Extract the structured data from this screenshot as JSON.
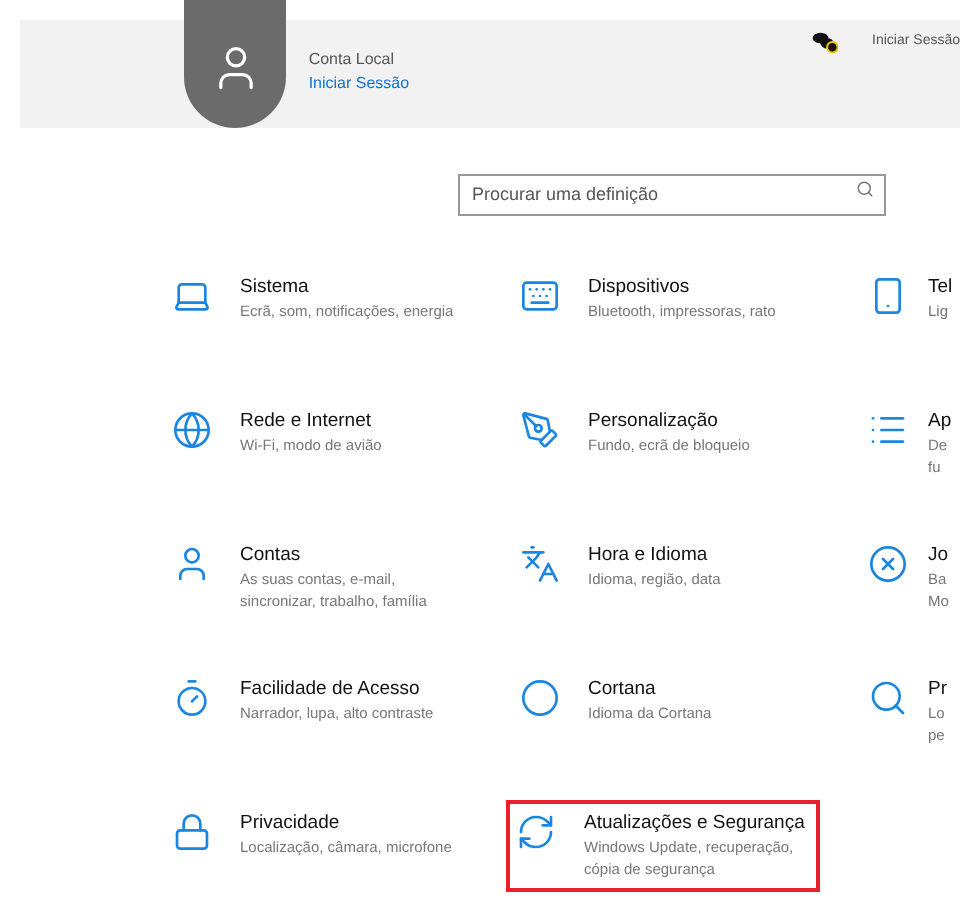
{
  "account": {
    "type": "Conta Local",
    "sign_in": "Iniciar Sessão"
  },
  "onedrive": {
    "sign_in": "Iniciar Sessão"
  },
  "search": {
    "placeholder": "Procurar uma definição"
  },
  "settings": [
    {
      "title": "Sistema",
      "lines": [
        "Ecrã, som, notificações, energia"
      ],
      "highlighted": false
    },
    {
      "title": "Dispositivos",
      "lines": [
        "Bluetooth, impressoras, rato"
      ],
      "highlighted": false
    },
    {
      "title": "Tel",
      "lines": [
        "Lig"
      ],
      "highlighted": false
    },
    {
      "title": "Rede e Internet",
      "lines": [
        "Wi-Fi, modo de avião"
      ],
      "highlighted": false
    },
    {
      "title": "Personalização",
      "lines": [
        "Fundo, ecrã de bloqueio"
      ],
      "highlighted": false
    },
    {
      "title": "Ap",
      "lines": [
        "De",
        "fu"
      ],
      "highlighted": false
    },
    {
      "title": "Contas",
      "lines": [
        "As suas contas, e-mail,",
        "sincronizar, trabalho, família"
      ],
      "highlighted": false
    },
    {
      "title": "Hora e Idioma",
      "lines": [
        "Idioma, região, data"
      ],
      "highlighted": false
    },
    {
      "title": "Jo",
      "lines": [
        "Ba",
        "Mo"
      ],
      "highlighted": false
    },
    {
      "title": "Facilidade de Acesso",
      "lines": [
        "Narrador, lupa, alto contraste"
      ],
      "highlighted": false
    },
    {
      "title": "Cortana",
      "lines": [
        "Idioma da Cortana"
      ],
      "highlighted": false
    },
    {
      "title": "Pr",
      "lines": [
        "Lo",
        "pe"
      ],
      "highlighted": false
    },
    {
      "title": "Privacidade",
      "lines": [
        "Localização, câmara, microfone"
      ],
      "highlighted": false
    },
    {
      "title": "Atualizações e Segurança",
      "lines": [
        "Windows Update, recuperação,",
        "cópia de segurança"
      ],
      "highlighted": true
    }
  ]
}
